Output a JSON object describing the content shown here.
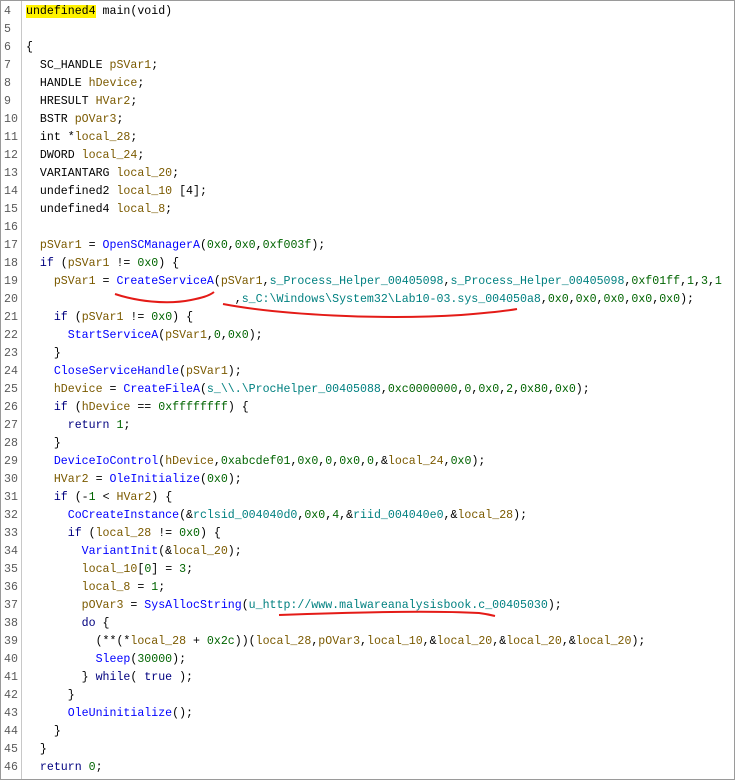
{
  "editor": {
    "lines": [
      {
        "n": "4",
        "t": [
          [
            "hl",
            "undefined4"
          ],
          [
            "op",
            " main(void)"
          ]
        ]
      },
      {
        "n": "5",
        "t": []
      },
      {
        "n": "6",
        "t": [
          [
            "op",
            "{"
          ]
        ]
      },
      {
        "n": "7",
        "t": [
          [
            "op",
            "  SC_HANDLE "
          ],
          [
            "var",
            "pSVar1"
          ],
          [
            "op",
            ";"
          ]
        ]
      },
      {
        "n": "8",
        "t": [
          [
            "op",
            "  HANDLE "
          ],
          [
            "var",
            "hDevice"
          ],
          [
            "op",
            ";"
          ]
        ]
      },
      {
        "n": "9",
        "t": [
          [
            "op",
            "  HRESULT "
          ],
          [
            "var",
            "HVar2"
          ],
          [
            "op",
            ";"
          ]
        ]
      },
      {
        "n": "10",
        "t": [
          [
            "op",
            "  BSTR "
          ],
          [
            "var",
            "pOVar3"
          ],
          [
            "op",
            ";"
          ]
        ]
      },
      {
        "n": "11",
        "t": [
          [
            "op",
            "  int *"
          ],
          [
            "var",
            "local_28"
          ],
          [
            "op",
            ";"
          ]
        ]
      },
      {
        "n": "12",
        "t": [
          [
            "op",
            "  DWORD "
          ],
          [
            "var",
            "local_24"
          ],
          [
            "op",
            ";"
          ]
        ]
      },
      {
        "n": "13",
        "t": [
          [
            "op",
            "  VARIANTARG "
          ],
          [
            "var",
            "local_20"
          ],
          [
            "op",
            ";"
          ]
        ]
      },
      {
        "n": "14",
        "t": [
          [
            "op",
            "  undefined2 "
          ],
          [
            "var",
            "local_10"
          ],
          [
            "op",
            " [4];"
          ]
        ]
      },
      {
        "n": "15",
        "t": [
          [
            "op",
            "  undefined4 "
          ],
          [
            "var",
            "local_8"
          ],
          [
            "op",
            ";"
          ]
        ]
      },
      {
        "n": "16",
        "t": []
      },
      {
        "n": "17",
        "t": [
          [
            "op",
            "  "
          ],
          [
            "var",
            "pSVar1"
          ],
          [
            "op",
            " = "
          ],
          [
            "fn",
            "OpenSCManagerA"
          ],
          [
            "op",
            "("
          ],
          [
            "num",
            "0x0"
          ],
          [
            "op",
            ","
          ],
          [
            "num",
            "0x0"
          ],
          [
            "op",
            ","
          ],
          [
            "num",
            "0xf003f"
          ],
          [
            "op",
            ");"
          ]
        ]
      },
      {
        "n": "18",
        "t": [
          [
            "op",
            "  "
          ],
          [
            "kw",
            "if"
          ],
          [
            "op",
            " ("
          ],
          [
            "var",
            "pSVar1"
          ],
          [
            "op",
            " != "
          ],
          [
            "num",
            "0x0"
          ],
          [
            "op",
            ") {"
          ]
        ]
      },
      {
        "n": "19",
        "t": [
          [
            "op",
            "    "
          ],
          [
            "var",
            "pSVar1"
          ],
          [
            "op",
            " = "
          ],
          [
            "fn",
            "CreateServiceA"
          ],
          [
            "op",
            "("
          ],
          [
            "var",
            "pSVar1"
          ],
          [
            "op",
            ","
          ],
          [
            "glob",
            "s_Process_Helper_00405098"
          ],
          [
            "op",
            ","
          ],
          [
            "glob",
            "s_Process_Helper_00405098"
          ],
          [
            "op",
            ","
          ],
          [
            "num",
            "0xf01ff"
          ],
          [
            "op",
            ","
          ],
          [
            "num",
            "1"
          ],
          [
            "op",
            ","
          ],
          [
            "num",
            "3"
          ],
          [
            "op",
            ","
          ],
          [
            "num",
            "1"
          ]
        ]
      },
      {
        "n": "20",
        "t": [
          [
            "op",
            "                              ,"
          ],
          [
            "glob",
            "s_C:\\Windows\\System32\\Lab10-03.sys_004050a8"
          ],
          [
            "op",
            ","
          ],
          [
            "num",
            "0x0"
          ],
          [
            "op",
            ","
          ],
          [
            "num",
            "0x0"
          ],
          [
            "op",
            ","
          ],
          [
            "num",
            "0x0"
          ],
          [
            "op",
            ","
          ],
          [
            "num",
            "0x0"
          ],
          [
            "op",
            ","
          ],
          [
            "num",
            "0x0"
          ],
          [
            "op",
            ");"
          ]
        ]
      },
      {
        "n": "21",
        "t": [
          [
            "op",
            "    "
          ],
          [
            "kw",
            "if"
          ],
          [
            "op",
            " ("
          ],
          [
            "var",
            "pSVar1"
          ],
          [
            "op",
            " != "
          ],
          [
            "num",
            "0x0"
          ],
          [
            "op",
            ") {"
          ]
        ]
      },
      {
        "n": "22",
        "t": [
          [
            "op",
            "      "
          ],
          [
            "fn",
            "StartServiceA"
          ],
          [
            "op",
            "("
          ],
          [
            "var",
            "pSVar1"
          ],
          [
            "op",
            ","
          ],
          [
            "num",
            "0"
          ],
          [
            "op",
            ","
          ],
          [
            "num",
            "0x0"
          ],
          [
            "op",
            ");"
          ]
        ]
      },
      {
        "n": "23",
        "t": [
          [
            "op",
            "    }"
          ]
        ]
      },
      {
        "n": "24",
        "t": [
          [
            "op",
            "    "
          ],
          [
            "fn",
            "CloseServiceHandle"
          ],
          [
            "op",
            "("
          ],
          [
            "var",
            "pSVar1"
          ],
          [
            "op",
            ");"
          ]
        ]
      },
      {
        "n": "25",
        "t": [
          [
            "op",
            "    "
          ],
          [
            "var",
            "hDevice"
          ],
          [
            "op",
            " = "
          ],
          [
            "fn",
            "CreateFileA"
          ],
          [
            "op",
            "("
          ],
          [
            "glob",
            "s_\\\\.\\ProcHelper_00405088"
          ],
          [
            "op",
            ","
          ],
          [
            "num",
            "0xc0000000"
          ],
          [
            "op",
            ","
          ],
          [
            "num",
            "0"
          ],
          [
            "op",
            ","
          ],
          [
            "num",
            "0x0"
          ],
          [
            "op",
            ","
          ],
          [
            "num",
            "2"
          ],
          [
            "op",
            ","
          ],
          [
            "num",
            "0x80"
          ],
          [
            "op",
            ","
          ],
          [
            "num",
            "0x0"
          ],
          [
            "op",
            ");"
          ]
        ]
      },
      {
        "n": "26",
        "t": [
          [
            "op",
            "    "
          ],
          [
            "kw",
            "if"
          ],
          [
            "op",
            " ("
          ],
          [
            "var",
            "hDevice"
          ],
          [
            "op",
            " == "
          ],
          [
            "num",
            "0xffffffff"
          ],
          [
            "op",
            ") {"
          ]
        ]
      },
      {
        "n": "27",
        "t": [
          [
            "op",
            "      "
          ],
          [
            "kw",
            "return"
          ],
          [
            "op",
            " "
          ],
          [
            "num",
            "1"
          ],
          [
            "op",
            ";"
          ]
        ]
      },
      {
        "n": "28",
        "t": [
          [
            "op",
            "    }"
          ]
        ]
      },
      {
        "n": "29",
        "t": [
          [
            "op",
            "    "
          ],
          [
            "fn",
            "DeviceIoControl"
          ],
          [
            "op",
            "("
          ],
          [
            "var",
            "hDevice"
          ],
          [
            "op",
            ","
          ],
          [
            "num",
            "0xabcdef01"
          ],
          [
            "op",
            ","
          ],
          [
            "num",
            "0x0"
          ],
          [
            "op",
            ","
          ],
          [
            "num",
            "0"
          ],
          [
            "op",
            ","
          ],
          [
            "num",
            "0x0"
          ],
          [
            "op",
            ","
          ],
          [
            "num",
            "0"
          ],
          [
            "op",
            ",&"
          ],
          [
            "var",
            "local_24"
          ],
          [
            "op",
            ","
          ],
          [
            "num",
            "0x0"
          ],
          [
            "op",
            ");"
          ]
        ]
      },
      {
        "n": "30",
        "t": [
          [
            "op",
            "    "
          ],
          [
            "var",
            "HVar2"
          ],
          [
            "op",
            " = "
          ],
          [
            "fn",
            "OleInitialize"
          ],
          [
            "op",
            "("
          ],
          [
            "num",
            "0x0"
          ],
          [
            "op",
            ");"
          ]
        ]
      },
      {
        "n": "31",
        "t": [
          [
            "op",
            "    "
          ],
          [
            "kw",
            "if"
          ],
          [
            "op",
            " (-"
          ],
          [
            "num",
            "1"
          ],
          [
            "op",
            " < "
          ],
          [
            "var",
            "HVar2"
          ],
          [
            "op",
            ") {"
          ]
        ]
      },
      {
        "n": "32",
        "t": [
          [
            "op",
            "      "
          ],
          [
            "fn",
            "CoCreateInstance"
          ],
          [
            "op",
            "(&"
          ],
          [
            "glob",
            "rclsid_004040d0"
          ],
          [
            "op",
            ","
          ],
          [
            "num",
            "0x0"
          ],
          [
            "op",
            ","
          ],
          [
            "num",
            "4"
          ],
          [
            "op",
            ",&"
          ],
          [
            "glob",
            "riid_004040e0"
          ],
          [
            "op",
            ",&"
          ],
          [
            "var",
            "local_28"
          ],
          [
            "op",
            ");"
          ]
        ]
      },
      {
        "n": "33",
        "t": [
          [
            "op",
            "      "
          ],
          [
            "kw",
            "if"
          ],
          [
            "op",
            " ("
          ],
          [
            "var",
            "local_28"
          ],
          [
            "op",
            " != "
          ],
          [
            "num",
            "0x0"
          ],
          [
            "op",
            ") {"
          ]
        ]
      },
      {
        "n": "34",
        "t": [
          [
            "op",
            "        "
          ],
          [
            "fn",
            "VariantInit"
          ],
          [
            "op",
            "(&"
          ],
          [
            "var",
            "local_20"
          ],
          [
            "op",
            ");"
          ]
        ]
      },
      {
        "n": "35",
        "t": [
          [
            "op",
            "        "
          ],
          [
            "var",
            "local_10"
          ],
          [
            "op",
            "["
          ],
          [
            "num",
            "0"
          ],
          [
            "op",
            "] = "
          ],
          [
            "num",
            "3"
          ],
          [
            "op",
            ";"
          ]
        ]
      },
      {
        "n": "36",
        "t": [
          [
            "op",
            "        "
          ],
          [
            "var",
            "local_8"
          ],
          [
            "op",
            " = "
          ],
          [
            "num",
            "1"
          ],
          [
            "op",
            ";"
          ]
        ]
      },
      {
        "n": "37",
        "t": [
          [
            "op",
            "        "
          ],
          [
            "var",
            "pOVar3"
          ],
          [
            "op",
            " = "
          ],
          [
            "fn",
            "SysAllocString"
          ],
          [
            "op",
            "("
          ],
          [
            "glob",
            "u_http://www.malwareanalysisbook.c_00405030"
          ],
          [
            "op",
            ");"
          ]
        ]
      },
      {
        "n": "38",
        "t": [
          [
            "op",
            "        "
          ],
          [
            "kw",
            "do"
          ],
          [
            "op",
            " {"
          ]
        ]
      },
      {
        "n": "39",
        "t": [
          [
            "op",
            "          (**(*"
          ],
          [
            "var",
            "local_28"
          ],
          [
            "op",
            " + "
          ],
          [
            "num",
            "0x2c"
          ],
          [
            "op",
            "))("
          ],
          [
            "var",
            "local_28"
          ],
          [
            "op",
            ","
          ],
          [
            "var",
            "pOVar3"
          ],
          [
            "op",
            ","
          ],
          [
            "var",
            "local_10"
          ],
          [
            "op",
            ",&"
          ],
          [
            "var",
            "local_20"
          ],
          [
            "op",
            ",&"
          ],
          [
            "var",
            "local_20"
          ],
          [
            "op",
            ",&"
          ],
          [
            "var",
            "local_20"
          ],
          [
            "op",
            ");"
          ]
        ]
      },
      {
        "n": "40",
        "t": [
          [
            "op",
            "          "
          ],
          [
            "fn",
            "Sleep"
          ],
          [
            "op",
            "("
          ],
          [
            "num",
            "30000"
          ],
          [
            "op",
            ");"
          ]
        ]
      },
      {
        "n": "41",
        "t": [
          [
            "op",
            "        } "
          ],
          [
            "kw",
            "while"
          ],
          [
            "op",
            "( "
          ],
          [
            "kw",
            "true"
          ],
          [
            "op",
            " );"
          ]
        ]
      },
      {
        "n": "42",
        "t": [
          [
            "op",
            "      }"
          ]
        ]
      },
      {
        "n": "43",
        "t": [
          [
            "op",
            "      "
          ],
          [
            "fn",
            "OleUninitialize"
          ],
          [
            "op",
            "();"
          ]
        ]
      },
      {
        "n": "44",
        "t": [
          [
            "op",
            "    }"
          ]
        ]
      },
      {
        "n": "45",
        "t": [
          [
            "op",
            "  }"
          ]
        ]
      },
      {
        "n": "46",
        "t": [
          [
            "op",
            "  "
          ],
          [
            "kw",
            "return"
          ],
          [
            "op",
            " "
          ],
          [
            "num",
            "0"
          ],
          [
            "op",
            ";"
          ]
        ]
      }
    ]
  },
  "colors": {
    "annotation": "#e41b17",
    "highlight": "#fff200"
  }
}
